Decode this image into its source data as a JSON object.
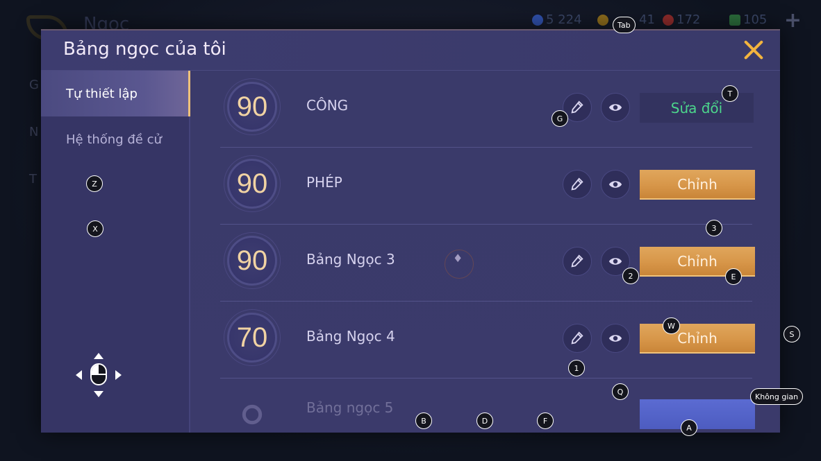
{
  "background": {
    "screen_title": "Ngọc",
    "side_letters": [
      "G",
      "N",
      "T"
    ],
    "hud": [
      {
        "icon": "blue-gem-icon",
        "color": "#2f4fa8",
        "value": "5 224"
      },
      {
        "icon": "gold-coin-icon",
        "color": "#8a6a1c",
        "value": "41"
      },
      {
        "icon": "red-gem-icon",
        "color": "#8a2a2a",
        "value": "172"
      },
      {
        "icon": "green-voucher-icon",
        "color": "#2a6a3a",
        "value": "105"
      }
    ]
  },
  "modal": {
    "title": "Bảng ngọc của tôi",
    "close_icon": "close-icon",
    "accent": "#f3b43e"
  },
  "sidebar": {
    "tabs": [
      {
        "label": "Tự thiết lập",
        "active": true
      },
      {
        "label": "Hệ thống đề cử",
        "active": false
      }
    ]
  },
  "rune_pages": [
    {
      "level": "90",
      "name": "CÔNG",
      "action": "Sửa đổi",
      "action_style": "dark"
    },
    {
      "level": "90",
      "name": "PHÉP",
      "action": "Chỉnh",
      "action_style": "gold"
    },
    {
      "level": "90",
      "name": "Bảng Ngọc 3",
      "action": "Chỉnh",
      "action_style": "gold"
    },
    {
      "level": "70",
      "name": "Bảng Ngọc 4",
      "action": "Chỉnh",
      "action_style": "gold"
    },
    {
      "level": "",
      "name": "Bảng ngọc 5",
      "action": "",
      "action_style": "blue"
    }
  ],
  "key_hints": {
    "tab": "Tab",
    "t": "T",
    "g": "G",
    "z": "Z",
    "x": "X",
    "three": "3",
    "two": "2",
    "e": "E",
    "w": "W",
    "s": "S",
    "one": "1",
    "q": "Q",
    "space": "Không gian",
    "b": "B",
    "d": "D",
    "f": "F",
    "a": "A"
  }
}
